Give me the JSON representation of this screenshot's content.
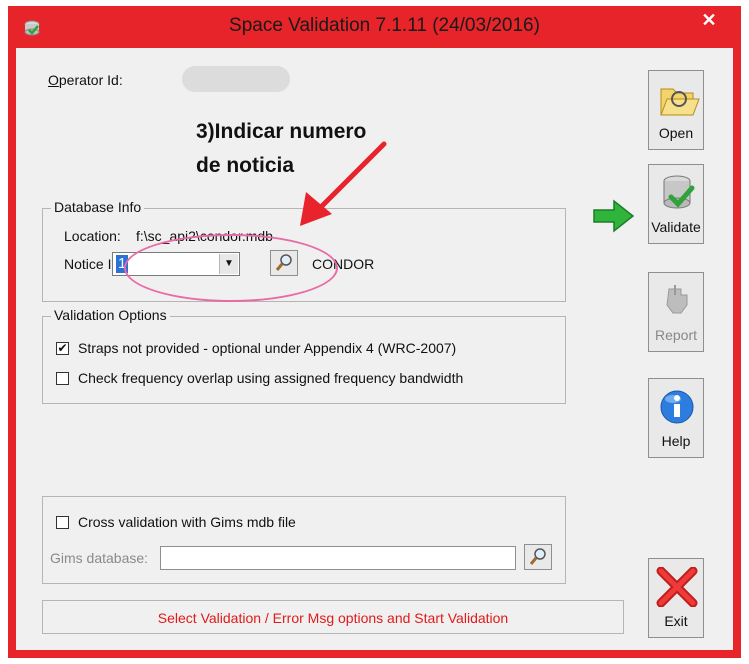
{
  "window": {
    "title": "Space Validation 7.1.11 (24/03/2016)",
    "close_glyph": "✕"
  },
  "operator": {
    "label": "Operator Id:",
    "label_access": "O",
    "label_rest": "perator Id:"
  },
  "annotation": {
    "line1": "3)Indicar numero",
    "line2": "de noticia"
  },
  "database_info": {
    "title": "Database Info",
    "location_label": "Location:",
    "location_value": "f:\\sc_api2\\condor.mdb",
    "notice_label": "Notice Id",
    "notice_value": "1",
    "name_value": "CONDOR"
  },
  "validation_options": {
    "title": "Validation Options",
    "options": [
      {
        "label": "Straps not provided - optional under Appendix 4 (WRC-2007)",
        "checked": true
      },
      {
        "label": "Check frequency overlap using assigned frequency bandwidth",
        "checked": false
      }
    ]
  },
  "cross_validation": {
    "checkbox_label": "Cross validation with Gims mdb file",
    "checked": false,
    "gims_label": "Gims database:",
    "gims_value": ""
  },
  "status": {
    "message": "Select Validation / Error Msg options and Start Validation"
  },
  "buttons": {
    "open": {
      "label": "Open",
      "icon": "folder-icon"
    },
    "validate": {
      "label": "Validate",
      "icon": "database-check-icon"
    },
    "report": {
      "label": "Report",
      "icon": "pointing-hand-icon"
    },
    "help": {
      "label": "Help",
      "icon": "info-icon"
    },
    "exit": {
      "label": "Exit",
      "icon": "red-x-icon"
    }
  },
  "colors": {
    "titlebar": "#e6242a",
    "status_text": "#e01b1b",
    "annotation_arrow": "#e8232b",
    "ellipse": "#e86aa6",
    "green_arrow": "#2fb53c"
  }
}
